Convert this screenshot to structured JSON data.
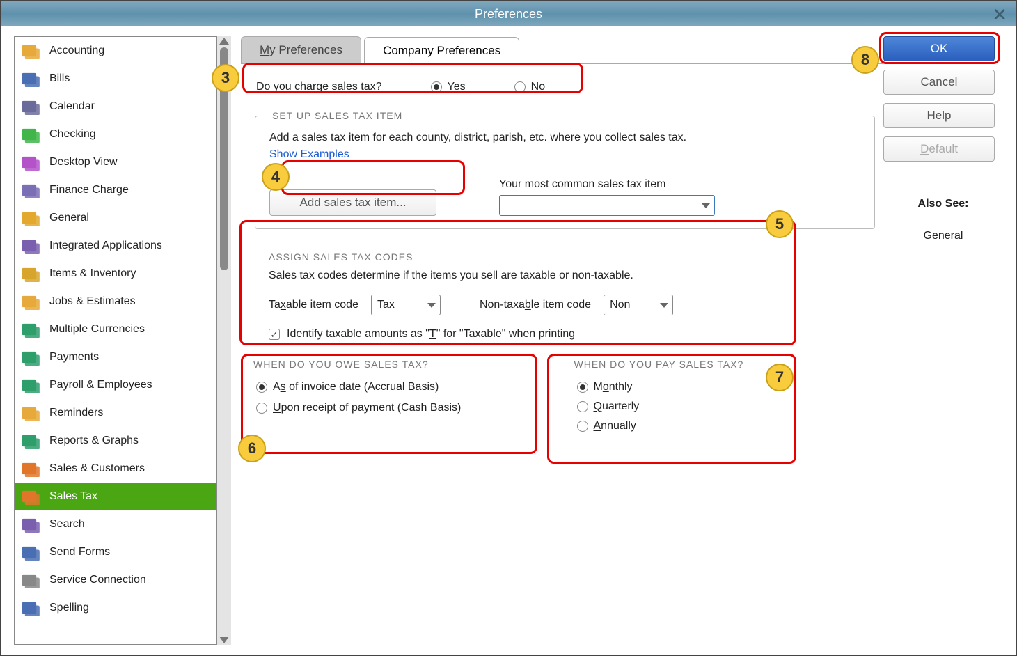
{
  "title": "Preferences",
  "tabs": {
    "my": "My Preferences",
    "company": "Company Preferences"
  },
  "sidebar": {
    "items": [
      {
        "label": "Accounting",
        "color": "#e6a93b"
      },
      {
        "label": "Bills",
        "color": "#4a6fb3"
      },
      {
        "label": "Calendar",
        "color": "#6b6b9b"
      },
      {
        "label": "Checking",
        "color": "#3fb54a"
      },
      {
        "label": "Desktop View",
        "color": "#b352c9"
      },
      {
        "label": "Finance Charge",
        "color": "#7b6fb5"
      },
      {
        "label": "General",
        "color": "#e2a92e"
      },
      {
        "label": "Integrated Applications",
        "color": "#7a5fae"
      },
      {
        "label": "Items & Inventory",
        "color": "#d8a52d"
      },
      {
        "label": "Jobs & Estimates",
        "color": "#e6a93b"
      },
      {
        "label": "Multiple Currencies",
        "color": "#2e9e6b"
      },
      {
        "label": "Payments",
        "color": "#2e9e6b"
      },
      {
        "label": "Payroll & Employees",
        "color": "#2e9e6b"
      },
      {
        "label": "Reminders",
        "color": "#e6a93b"
      },
      {
        "label": "Reports & Graphs",
        "color": "#2e9e6b"
      },
      {
        "label": "Sales & Customers",
        "color": "#e0762a"
      },
      {
        "label": "Sales Tax",
        "color": "#e0762a",
        "active": true
      },
      {
        "label": "Search",
        "color": "#7a5fae"
      },
      {
        "label": "Send Forms",
        "color": "#4a6fb3"
      },
      {
        "label": "Service Connection",
        "color": "#888"
      },
      {
        "label": "Spelling",
        "color": "#4a6fb3"
      }
    ]
  },
  "charge_q": {
    "label": "Do you charge sales tax?",
    "yes": "Yes",
    "no": "No",
    "selected": "yes"
  },
  "setup": {
    "legend": "SET UP SALES TAX ITEM",
    "desc": "Add a sales tax item for each county, district, parish, etc. where you collect sales tax.",
    "examples": "Show Examples",
    "add_btn": "Add sales tax item...",
    "common_label": "Your most common sales tax item",
    "common_value": ""
  },
  "codes": {
    "legend": "ASSIGN SALES TAX CODES",
    "desc": "Sales tax codes determine if the items you sell are taxable or non-taxable.",
    "taxable_label": "Taxable item code",
    "taxable_value": "Tax",
    "nontax_label": "Non-taxable item code",
    "nontax_value": "Non",
    "checkbox": "Identify taxable amounts as \"T\" for \"Taxable\" when printing",
    "checked": true
  },
  "owe": {
    "legend": "WHEN DO YOU OWE SALES TAX?",
    "opt1": "As of invoice date (Accrual Basis)",
    "opt2": "Upon receipt of payment (Cash Basis)",
    "selected": 0
  },
  "pay": {
    "legend": "WHEN DO YOU PAY SALES TAX?",
    "opt1": "Monthly",
    "opt2": "Quarterly",
    "opt3": "Annually",
    "selected": 0
  },
  "buttons": {
    "ok": "OK",
    "cancel": "Cancel",
    "help": "Help",
    "default": "Default"
  },
  "also_see": {
    "heading": "Also See:",
    "item": "General"
  },
  "callouts": {
    "c3": "3",
    "c4": "4",
    "c5": "5",
    "c6": "6",
    "c7": "7",
    "c8": "8"
  }
}
